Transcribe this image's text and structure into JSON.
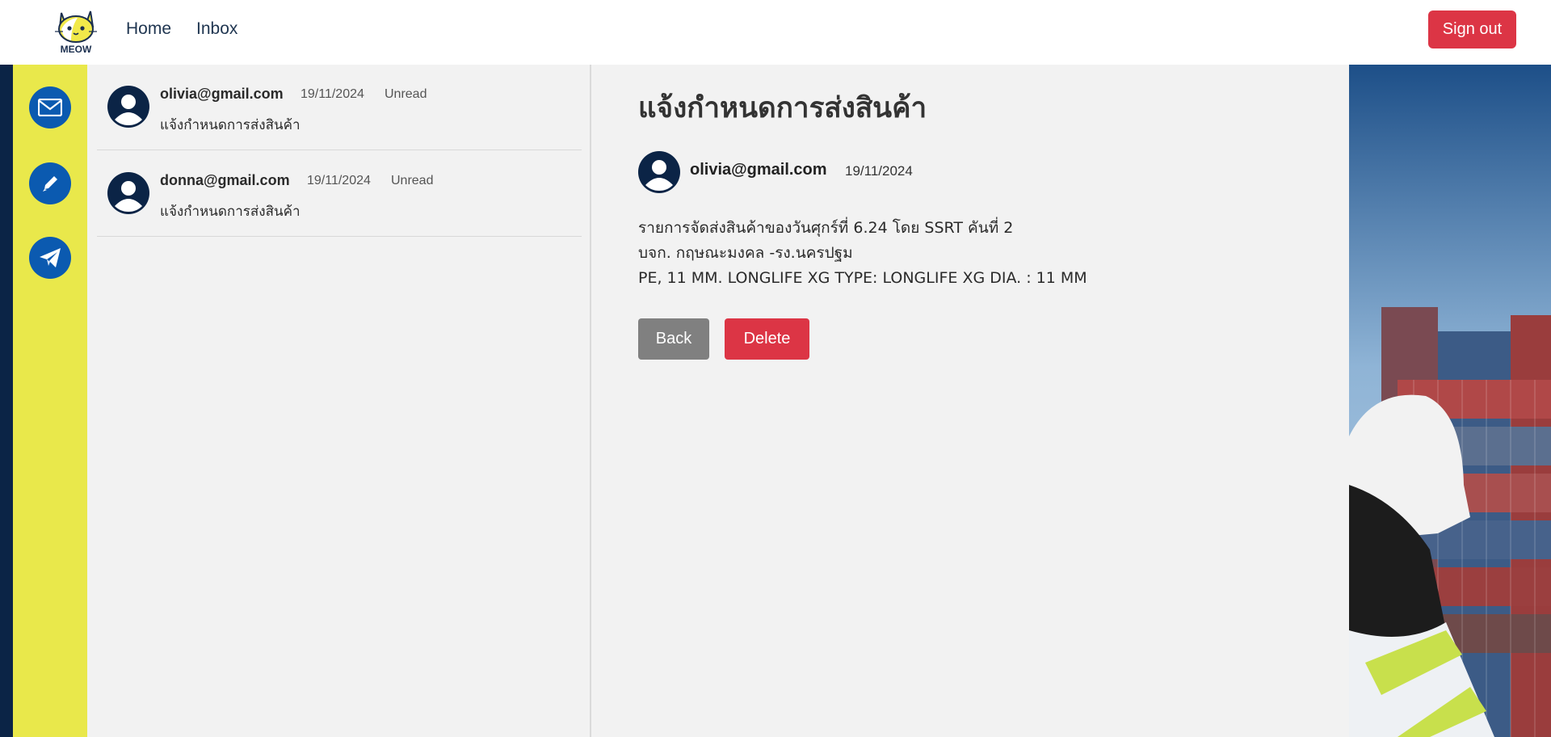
{
  "navbar": {
    "logo_text": "MEOW",
    "links": [
      {
        "label": "Home"
      },
      {
        "label": "Inbox"
      }
    ],
    "signout_label": "Sign out"
  },
  "sidebar": {
    "buttons": [
      {
        "icon": "envelope-icon"
      },
      {
        "icon": "pencil-icon"
      },
      {
        "icon": "paper-plane-icon"
      }
    ]
  },
  "messages": [
    {
      "from": "olivia@gmail.com",
      "date": "19/11/2024",
      "status": "Unread",
      "subject": "แจ้งกำหนดการส่งสินค้า"
    },
    {
      "from": "donna@gmail.com",
      "date": "19/11/2024",
      "status": "Unread",
      "subject": "แจ้งกำหนดการส่งสินค้า"
    }
  ],
  "detail": {
    "title": "แจ้งกำหนดการส่งสินค้า",
    "from": "olivia@gmail.com",
    "date": "19/11/2024",
    "body": [
      "รายการจัดส่งสินค้าของวันศุกร์ที่ 6.24 โดย SSRT คันที่ 2",
      "บจก. กฤษณะมงคล -รง.นครปฐม",
      "PE, 11 MM. LONGLIFE XG TYPE: LONGLIFE XG  DIA. : 11 MM"
    ],
    "back_label": "Back",
    "delete_label": "Delete"
  },
  "colors": {
    "navy": "#0b2446",
    "sidebar_yellow": "#e9e84b",
    "icon_blue": "#0b5ab0",
    "danger": "#dc3545",
    "secondary": "#808080",
    "panel_bg": "#f2f2f2"
  }
}
